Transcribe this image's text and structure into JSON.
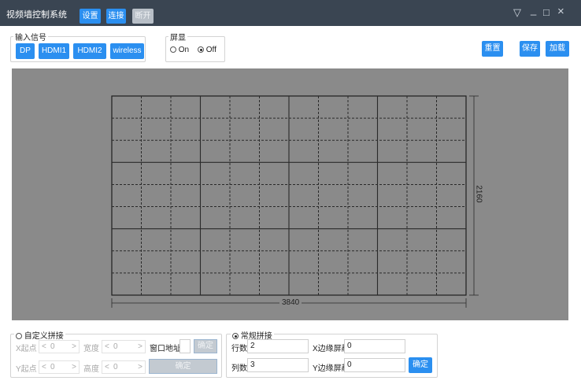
{
  "titlebar": {
    "title": "视频墙控制系统",
    "settings_label": "设置",
    "connect_label": "连接",
    "disconnect_label": "断开"
  },
  "input_signal": {
    "title": "输入信号",
    "buttons": [
      "DP",
      "HDMI1",
      "HDMI2",
      "wireless"
    ]
  },
  "screen_display": {
    "title": "屏显",
    "options": [
      {
        "label": "On",
        "selected": false
      },
      {
        "label": "Off",
        "selected": true
      }
    ]
  },
  "actions": {
    "reset_label": "重置",
    "save_label": "保存",
    "load_label": "加载"
  },
  "wall": {
    "width_label": "3840",
    "height_label": "2160",
    "rows": 3,
    "cols": 4
  },
  "custom_splice": {
    "title": "自定义拼接",
    "selected": false,
    "x_start_label": "X起点",
    "x_start_value": "0",
    "width_label": "宽度",
    "width_value": "0",
    "y_start_label": "Y起点",
    "y_start_value": "0",
    "height_label": "高度",
    "height_value": "0",
    "window_addr_label": "窗口地址",
    "window_addr_value": "",
    "confirm_label": "确定",
    "confirm2_label": "确定"
  },
  "regular_splice": {
    "title": "常规拼接",
    "selected": true,
    "rows_label": "行数",
    "rows_value": "2",
    "cols_label": "列数",
    "cols_value": "3",
    "x_edge_label": "X边缘屏蔽",
    "x_edge_value": "0",
    "y_edge_label": "Y边缘屏蔽",
    "y_edge_value": "0",
    "confirm_label": "确定"
  },
  "icons": {
    "collapse": "▽",
    "minimize": "_",
    "maximize": "□",
    "close": "×"
  }
}
